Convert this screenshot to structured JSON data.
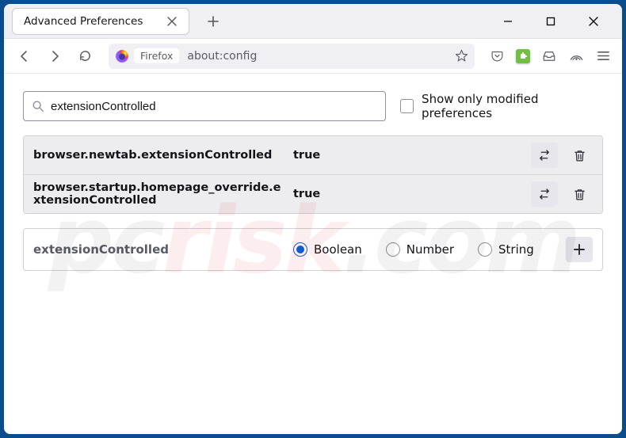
{
  "window": {
    "tab_title": "Advanced Preferences"
  },
  "urlbar": {
    "label": "Firefox",
    "url": "about:config"
  },
  "search": {
    "value": "extensionControlled",
    "show_modified_label": "Show only modified preferences"
  },
  "prefs": [
    {
      "name": "browser.newtab.extensionControlled",
      "value": "true"
    },
    {
      "name": "browser.startup.homepage_override.extensionControlled",
      "value": "true"
    }
  ],
  "new_pref": {
    "name": "extensionControlled",
    "types": [
      "Boolean",
      "Number",
      "String"
    ],
    "selected": "Boolean"
  },
  "watermark": {
    "a": "pc",
    "b": "risk",
    "c": ".com"
  }
}
